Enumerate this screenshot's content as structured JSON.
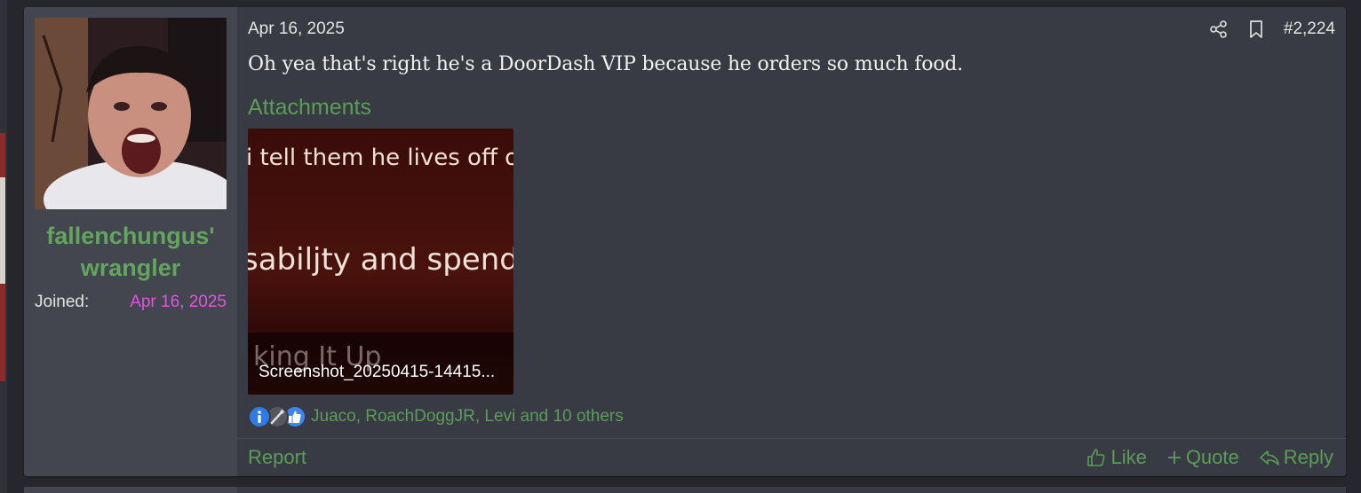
{
  "post": {
    "date": "Apr 16, 2025",
    "number": "#2,224",
    "message": "Oh yea that's right he's a DoorDash VIP because he orders so much food."
  },
  "author": {
    "username": "fallenchungus' wrangler",
    "joined_label": "Joined:",
    "joined_date": "Apr 16, 2025"
  },
  "attachments": {
    "title": "Attachments",
    "items": [
      {
        "filename": "Screenshot_20250415-14415...",
        "thumbnail_text": [
          "i tell them he lives off of d",
          "sabiljty and spends",
          "king It Up"
        ]
      }
    ]
  },
  "reactions": {
    "icons": [
      "info-icon",
      "tool-icon",
      "thumbs-up-icon"
    ],
    "users_text": "Juaco, RoachDoggJR, Levi and 10 others"
  },
  "footer": {
    "report": "Report",
    "like": "Like",
    "quote": "Quote",
    "reply": "Reply"
  },
  "colors": {
    "accent_green": "#5b9d58",
    "username_green": "#62a55e",
    "joined_date_magenta": "#e055e0",
    "post_bg": "#383b43",
    "user_col_bg": "#43464e"
  }
}
